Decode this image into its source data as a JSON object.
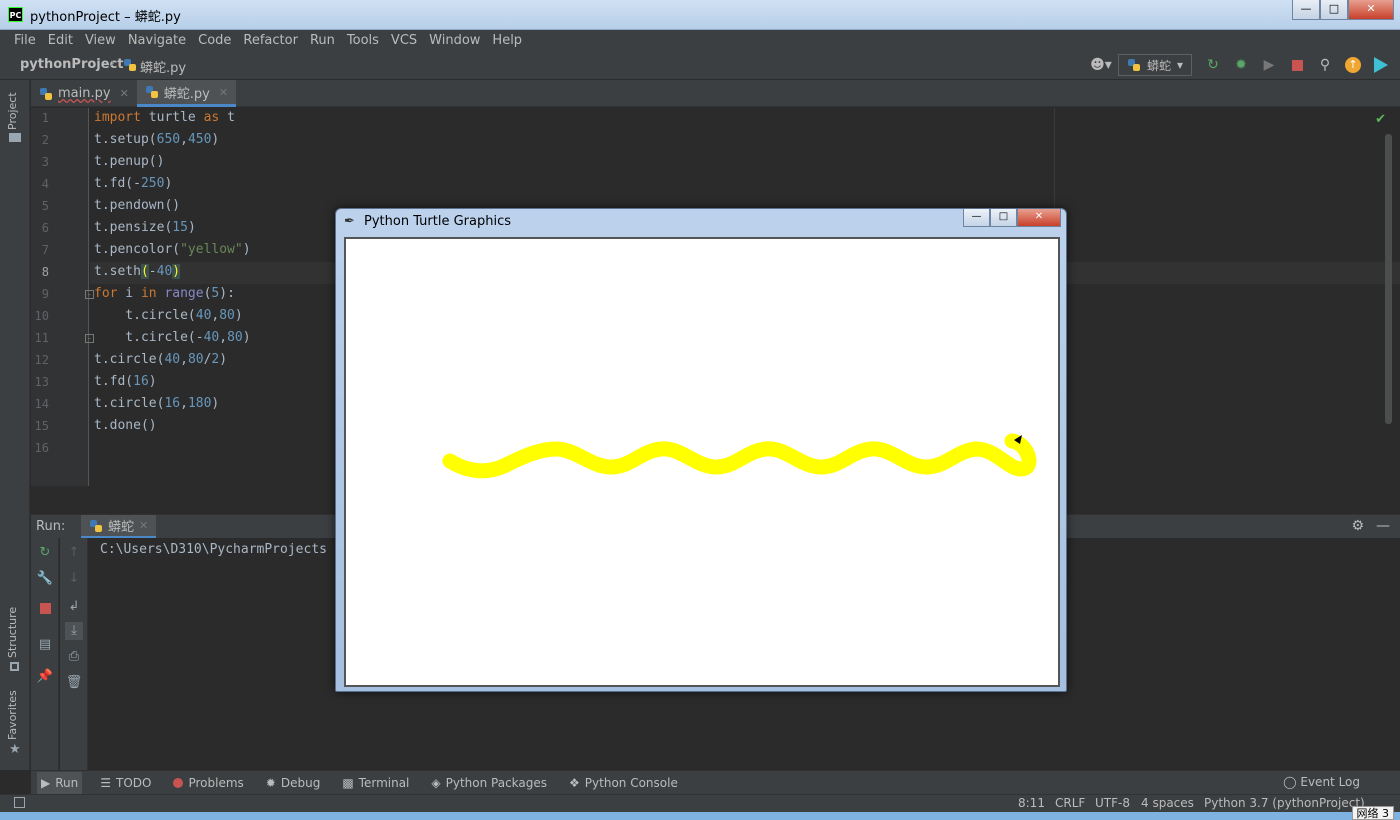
{
  "window": {
    "title": "pythonProject – 蟒蛇.py",
    "app_icon_text": "PC"
  },
  "menu": [
    "File",
    "Edit",
    "View",
    "Navigate",
    "Code",
    "Refactor",
    "Run",
    "Tools",
    "VCS",
    "Window",
    "Help"
  ],
  "navbar": {
    "project": "pythonProject",
    "file": "蟒蛇.py",
    "run_config": "蟒蛇"
  },
  "left_strip": {
    "project": "Project",
    "structure": "Structure",
    "favorites": "Favorites"
  },
  "editor_tabs": [
    {
      "label": "main.py",
      "active": false
    },
    {
      "label": "蟒蛇.py",
      "active": true
    }
  ],
  "code_lines": [
    "import turtle as t",
    "t.setup(650,450)",
    "t.penup()",
    "t.fd(-250)",
    "t.pendown()",
    "t.pensize(15)",
    "t.pencolor(\"yellow\")",
    "t.seth(-40)",
    "for i in range(5):",
    "    t.circle(40,80)",
    "    t.circle(-40,80)",
    "t.circle(40,80/2)",
    "t.fd(16)",
    "t.circle(16,180)",
    "t.done()",
    ""
  ],
  "line_numbers": [
    "1",
    "2",
    "3",
    "4",
    "5",
    "6",
    "7",
    "8",
    "9",
    "10",
    "11",
    "12",
    "13",
    "14",
    "15",
    "16"
  ],
  "run_panel": {
    "label": "Run:",
    "tab": "蟒蛇",
    "console_output": "C:\\Users\\D310\\PycharmProjects"
  },
  "turtle_window": {
    "title": "Python Turtle Graphics",
    "pen_color": "#ffff00"
  },
  "bottom_tabs": [
    {
      "label": "Run",
      "icon": "play-icon",
      "active": true
    },
    {
      "label": "TODO",
      "icon": "list-icon",
      "active": false
    },
    {
      "label": "Problems",
      "icon": "error-icon",
      "active": false
    },
    {
      "label": "Debug",
      "icon": "bug-icon",
      "active": false
    },
    {
      "label": "Terminal",
      "icon": "terminal-icon",
      "active": false
    },
    {
      "label": "Python Packages",
      "icon": "packages-icon",
      "active": false
    },
    {
      "label": "Python Console",
      "icon": "console-icon",
      "active": false
    }
  ],
  "event_log": "Event Log",
  "status": {
    "position": "8:11",
    "line_sep": "CRLF",
    "encoding": "UTF-8",
    "indent": "4 spaces",
    "interpreter": "Python 3.7 (pythonProject)"
  },
  "network_badge": "网络 3",
  "colors": {
    "keyword": "#cc7832",
    "number": "#6897bb",
    "string": "#6a8759",
    "builtin": "#8888c6",
    "accent": "#4a88c7"
  }
}
